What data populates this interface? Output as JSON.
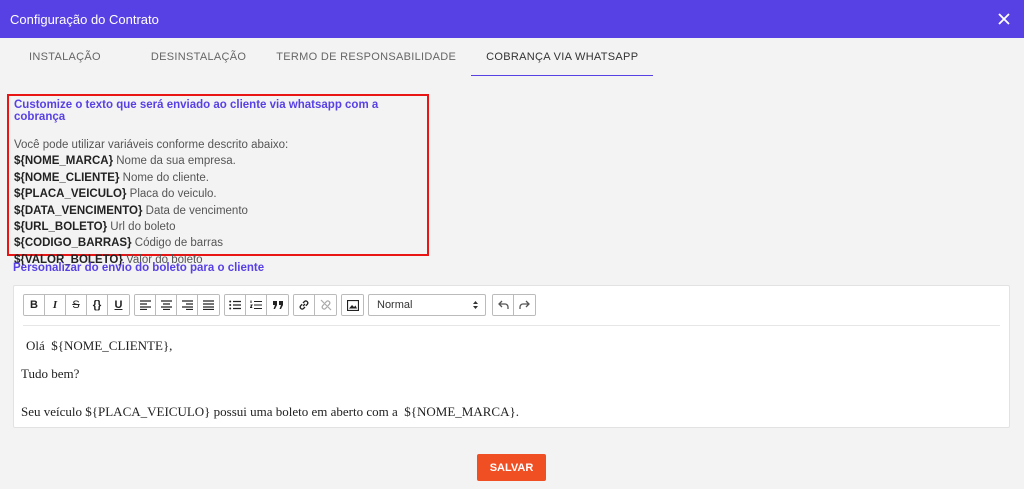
{
  "window": {
    "title": "Configuração do Contrato"
  },
  "tabs": [
    {
      "label": "INSTALAÇÃO"
    },
    {
      "label": "DESINSTALAÇÃO"
    },
    {
      "label": "TERMO DE RESPONSABILIDADE"
    },
    {
      "label": "COBRANÇA VIA WHATSAPP"
    }
  ],
  "info": {
    "title": "Customize o texto que será enviado ao cliente via whatsapp com a cobrança",
    "description": "Você pode utilizar variáveis conforme descrito abaixo:",
    "variables": [
      {
        "name": "${NOME_MARCA}",
        "desc": "Nome da sua empresa."
      },
      {
        "name": "${NOME_CLIENTE}",
        "desc": "Nome do cliente."
      },
      {
        "name": "${PLACA_VEICULO}",
        "desc": "Placa do veiculo."
      },
      {
        "name": "${DATA_VENCIMENTO}",
        "desc": "Data de vencimento"
      },
      {
        "name": "${URL_BOLETO}",
        "desc": "Url do boleto"
      },
      {
        "name": "${CODIGO_BARRAS}",
        "desc": "Código de barras"
      },
      {
        "name": "${VALOR_BOLETO}",
        "desc": "Valor do boleto"
      }
    ]
  },
  "section": {
    "title": "Personalizar do envio do boleto para o cliente"
  },
  "toolbar": {
    "bold": "B",
    "italic": "I",
    "strike": "S",
    "code": "{}",
    "underline": "U",
    "format_select": "Normal"
  },
  "editor": {
    "lines": [
      "Olá  ${NOME_CLIENTE},",
      "Tudo bem?",
      "Seu veículo ${PLACA_VEICULO} possui uma boleto em aberto com a  ${NOME_MARCA}."
    ]
  },
  "actions": {
    "save": "SALVAR"
  },
  "colors": {
    "header": "#5841e4",
    "accent": "#5841e4",
    "save": "#f04e23",
    "highlight": "#e91515"
  }
}
